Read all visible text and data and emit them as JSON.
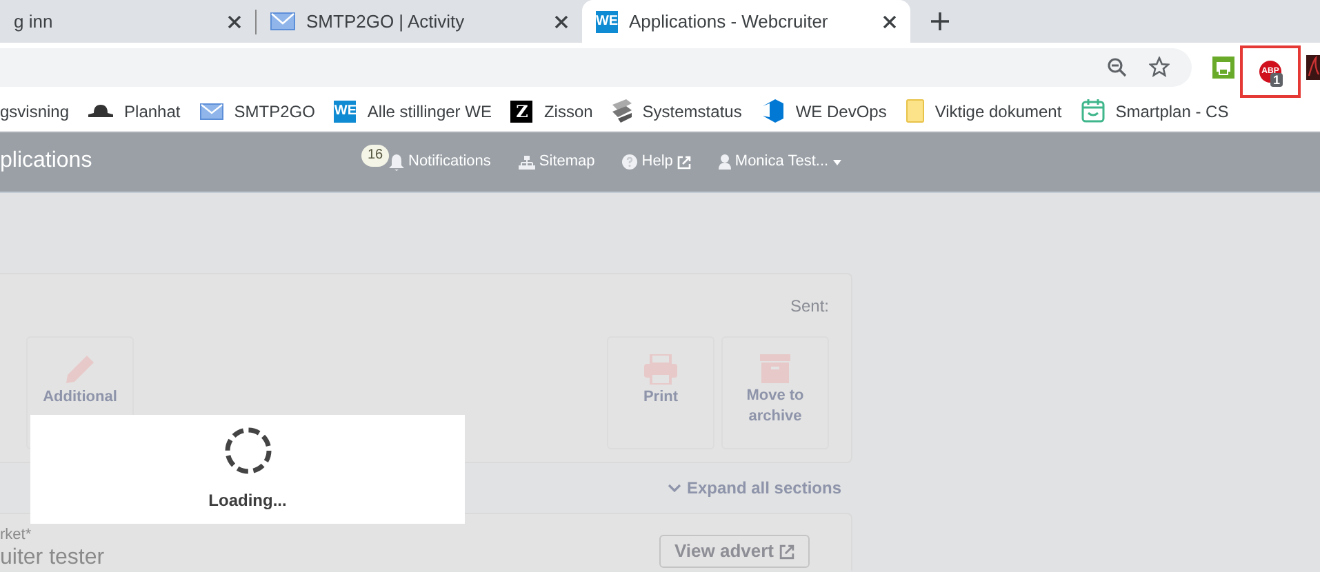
{
  "browser": {
    "tabs": [
      {
        "kind": "none",
        "title": "g inn",
        "selected": false
      },
      {
        "kind": "mail",
        "title": "SMTP2GO | Activity",
        "selected": false
      },
      {
        "kind": "we",
        "title": "Applications - Webcruiter",
        "selected": true,
        "icon_text": "WE"
      }
    ],
    "extensions": [
      {
        "kind": "printer",
        "highlighted": false
      },
      {
        "kind": "abp",
        "label": "ABP",
        "badge": "1",
        "highlighted": true
      },
      {
        "kind": "pdf",
        "highlighted": false
      }
    ],
    "bookmarks": [
      {
        "kind": "none",
        "label": "gsvisning"
      },
      {
        "kind": "hat",
        "label": "Planhat"
      },
      {
        "kind": "mail",
        "label": "SMTP2GO"
      },
      {
        "kind": "we",
        "icon_text": "WE",
        "label": "Alle stillinger WE"
      },
      {
        "kind": "z",
        "icon_text": "Z",
        "label": "Zisson"
      },
      {
        "kind": "s",
        "label": "Systemstatus"
      },
      {
        "kind": "devops",
        "label": "WE DevOps"
      },
      {
        "kind": "folder",
        "label": "Viktige dokument"
      },
      {
        "kind": "calendar",
        "label": "Smartplan - CS"
      }
    ]
  },
  "app": {
    "title": "plications",
    "notification_count": "16",
    "nav": [
      {
        "kind": "bell",
        "label": "Notifications",
        "external": false,
        "dropdown": false
      },
      {
        "kind": "sitemap",
        "label": "Sitemap",
        "external": false,
        "dropdown": false
      },
      {
        "kind": "help",
        "label": "Help",
        "external": true,
        "dropdown": false
      },
      {
        "kind": "user",
        "label": "Monica Test...",
        "external": false,
        "dropdown": true
      }
    ],
    "card": {
      "sent_label": "Sent:",
      "actions": [
        {
          "kind": "pencil",
          "label": "Additional"
        },
        {
          "kind": "printer",
          "label": "Print"
        },
        {
          "kind": "archive",
          "label": "Move to archive"
        }
      ]
    },
    "expand_all": "Expand all sections",
    "field": {
      "label": "rket*",
      "value": "uiter tester",
      "button": "View advert"
    },
    "loading": "Loading..."
  }
}
